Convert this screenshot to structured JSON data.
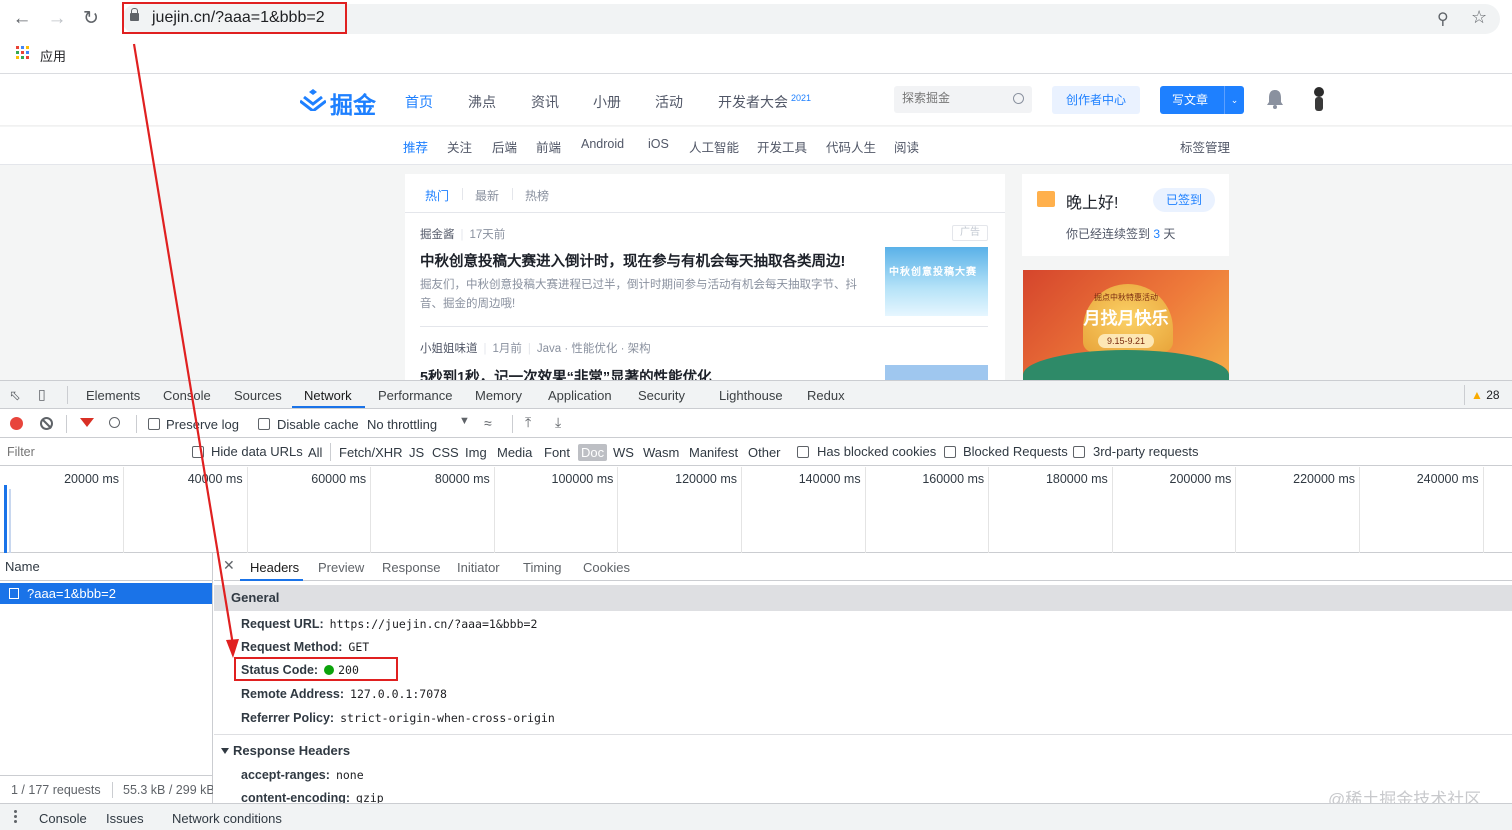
{
  "browser": {
    "url": "juejin.cn/?aaa=1&bbb=2",
    "bookmarks_apps_label": "应用",
    "icons": [
      "back-icon",
      "forward-icon",
      "reload-icon",
      "lock-icon",
      "zoom-icon",
      "star-icon",
      "apps-icon"
    ]
  },
  "juejin": {
    "logo_text": "掘金",
    "nav": [
      "首页",
      "沸点",
      "资讯",
      "小册",
      "活动"
    ],
    "nav_active": "首页",
    "conference_label": "开发者大会",
    "conference_year": "2021",
    "search_placeholder": "探索掘金",
    "creator_button": "创作者中心",
    "write_button": "写文章",
    "subnav": [
      "推荐",
      "关注",
      "后端",
      "前端",
      "Android",
      "iOS",
      "人工智能",
      "开发工具",
      "代码人生",
      "阅读"
    ],
    "subnav_active": "推荐",
    "tag_manage": "标签管理",
    "feed_tabs": [
      "热门",
      "最新",
      "热榜"
    ],
    "feed_tab_active": "热门",
    "articles": [
      {
        "author": "掘金酱",
        "time": "17天前",
        "ad_badge": "广告",
        "title": "中秋创意投稿大赛进入倒计时，现在参与有机会每天抽取各类周边!",
        "abstract_line1": "掘友们，中秋创意投稿大赛进程已过半，倒计时期间参与活动有机会每天抽取字节、抖",
        "abstract_line2": "音、掘金的周边哦!",
        "thumb_text": "中秋创意投稿大赛"
      },
      {
        "author": "小姐姐味道",
        "time": "1月前",
        "tags": "Java · 性能优化 · 架构",
        "title": "5秒到1秒，记一次效果“非常”显著的性能优化"
      }
    ],
    "sign": {
      "greeting": "晚上好!",
      "button": "已签到",
      "days_prefix": "你已经连续签到 ",
      "days": "3",
      "days_suffix": " 天"
    },
    "banner": {
      "kicker": "掘点中秋特惠活动",
      "title": "月找月快乐",
      "date": "9.15-9.21"
    }
  },
  "devtools": {
    "panel_tabs": [
      "Elements",
      "Console",
      "Sources",
      "Network",
      "Performance",
      "Memory",
      "Application",
      "Security",
      "Lighthouse",
      "Redux"
    ],
    "active_panel": "Network",
    "warning_count": "28",
    "toolbar": {
      "preserve_log": "Preserve log",
      "disable_cache": "Disable cache",
      "throttling": "No throttling"
    },
    "filter": {
      "placeholder": "Filter",
      "hide_data_urls": "Hide data URLs",
      "types": [
        "All",
        "Fetch/XHR",
        "JS",
        "CSS",
        "Img",
        "Media",
        "Font",
        "Doc",
        "WS",
        "Wasm",
        "Manifest",
        "Other"
      ],
      "active_type": "Doc",
      "has_blocked_cookies": "Has blocked cookies",
      "blocked_requests": "Blocked Requests",
      "third_party": "3rd-party requests"
    },
    "overview_ticks": [
      "20000 ms",
      "40000 ms",
      "60000 ms",
      "80000 ms",
      "100000 ms",
      "120000 ms",
      "140000 ms",
      "160000 ms",
      "180000 ms",
      "200000 ms",
      "220000 ms",
      "240000 ms"
    ],
    "request_list": {
      "header": "Name",
      "rows": [
        "?aaa=1&bbb=2"
      ],
      "footer_requests": "1 / 177 requests",
      "footer_size": "55.3 kB / 299 kB"
    },
    "detail_tabs": [
      "Headers",
      "Preview",
      "Response",
      "Initiator",
      "Timing",
      "Cookies"
    ],
    "active_detail_tab": "Headers",
    "general": {
      "title": "General",
      "rows": [
        {
          "key": "Request URL:",
          "value": "https://juejin.cn/?aaa=1&bbb=2"
        },
        {
          "key": "Request Method:",
          "value": "GET"
        },
        {
          "key": "Status Code:",
          "value": "200"
        },
        {
          "key": "Remote Address:",
          "value": "127.0.0.1:7078"
        },
        {
          "key": "Referrer Policy:",
          "value": "strict-origin-when-cross-origin"
        }
      ]
    },
    "response_headers": {
      "title": "Response Headers",
      "rows": [
        {
          "key": "accept-ranges:",
          "value": "none"
        },
        {
          "key": "content-encoding:",
          "value": "gzip"
        }
      ]
    },
    "drawer_tabs": [
      "Console",
      "Issues",
      "Network conditions"
    ]
  },
  "watermark": "@稀土掘金技术社区",
  "annotation_color": "#e02020"
}
